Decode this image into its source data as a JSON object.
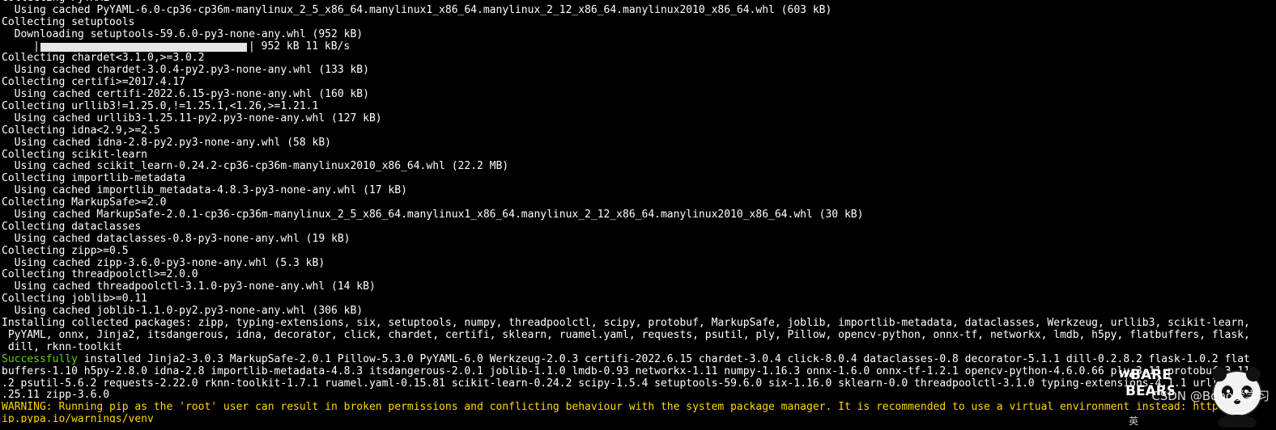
{
  "terminal": {
    "lines": [
      {
        "text": "Collecting PyYAML"
      },
      {
        "text": "  Using cached PyYAML-6.0-cp36-cp36m-manylinux_2_5_x86_64.manylinux1_x86_64.manylinux_2_12_x86_64.manylinux2010_x86_64.whl (603 kB)"
      },
      {
        "text": "Collecting setuptools"
      },
      {
        "text": "  Downloading setuptools-59.6.0-py3-none-any.whl (952 kB)"
      },
      {
        "type": "progress",
        "prefix": "     |",
        "suffix": "| 952 kB 11 kB/s",
        "progress": 1.0
      },
      {
        "text": "Collecting chardet<3.1.0,>=3.0.2"
      },
      {
        "text": "  Using cached chardet-3.0.4-py2.py3-none-any.whl (133 kB)"
      },
      {
        "text": "Collecting certifi>=2017.4.17"
      },
      {
        "text": "  Using cached certifi-2022.6.15-py3-none-any.whl (160 kB)"
      },
      {
        "text": "Collecting urllib3!=1.25.0,!=1.25.1,<1.26,>=1.21.1"
      },
      {
        "text": "  Using cached urllib3-1.25.11-py2.py3-none-any.whl (127 kB)"
      },
      {
        "text": "Collecting idna<2.9,>=2.5"
      },
      {
        "text": "  Using cached idna-2.8-py2.py3-none-any.whl (58 kB)"
      },
      {
        "text": "Collecting scikit-learn"
      },
      {
        "text": "  Using cached scikit_learn-0.24.2-cp36-cp36m-manylinux2010_x86_64.whl (22.2 MB)"
      },
      {
        "text": "Collecting importlib-metadata"
      },
      {
        "text": "  Using cached importlib_metadata-4.8.3-py3-none-any.whl (17 kB)"
      },
      {
        "text": "Collecting MarkupSafe>=2.0"
      },
      {
        "text": "  Using cached MarkupSafe-2.0.1-cp36-cp36m-manylinux_2_5_x86_64.manylinux1_x86_64.manylinux_2_12_x86_64.manylinux2010_x86_64.whl (30 kB)"
      },
      {
        "text": "Collecting dataclasses"
      },
      {
        "text": "  Using cached dataclasses-0.8-py3-none-any.whl (19 kB)"
      },
      {
        "text": "Collecting zipp>=0.5"
      },
      {
        "text": "  Using cached zipp-3.6.0-py3-none-any.whl (5.3 kB)"
      },
      {
        "text": "Collecting threadpoolctl>=2.0.0"
      },
      {
        "text": "  Using cached threadpoolctl-3.1.0-py3-none-any.whl (14 kB)"
      },
      {
        "text": "Collecting joblib>=0.11"
      },
      {
        "text": "  Using cached joblib-1.1.0-py2.py3-none-any.whl (306 kB)"
      },
      {
        "text": "Installing collected packages: zipp, typing-extensions, six, setuptools, numpy, threadpoolctl, scipy, protobuf, MarkupSafe, joblib, importlib-metadata, dataclasses, Werkzeug, urllib3, scikit-learn,"
      },
      {
        "text": " PyYAML, onnx, Jinja2, itsdangerous, idna, decorator, click, chardet, certifi, sklearn, ruamel.yaml, requests, psutil, ply, Pillow, opencv-python, onnx-tf, networkx, lmdb, h5py, flatbuffers, flask,"
      },
      {
        "text": " dill, rknn-toolkit"
      },
      {
        "type": "success",
        "highlight": "Successfully",
        "text": " installed Jinja2-3.0.3 MarkupSafe-2.0.1 Pillow-5.3.0 PyYAML-6.0 Werkzeug-2.0.3 certifi-2022.6.15 chardet-3.0.4 click-8.0.4 dataclasses-0.8 decorator-5.1.1 dill-0.2.8.2 flask-1.0.2 flat"
      },
      {
        "text": "buffers-1.10 h5py-2.8.0 idna-2.8 importlib-metadata-4.8.3 itsdangerous-2.0.1 joblib-1.1.0 lmdb-0.93 networkx-1.11 numpy-1.16.3 onnx-1.6.0 onnx-tf-1.2.1 opencv-python-4.6.0.66 ply-3.11 protobuf-3.11"
      },
      {
        "text": ".2 psutil-5.6.2 requests-2.22.0 rknn-toolkit-1.7.1 ruamel.yaml-0.15.81 scikit-learn-0.24.2 scipy-1.5.4 setuptools-59.6.0 six-1.16.0 sklearn-0.0 threadpoolctl-3.1.0 typing-extensions-4.1.1 urllib3-1"
      },
      {
        "text": ".25.11 zipp-3.6.0"
      },
      {
        "type": "warning",
        "text": "WARNING: Running pip as the 'root' user can result in broken permissions and conflicting behaviour with the system package manager. It is recommended to use a virtual environment instead: https://p"
      },
      {
        "type": "warning",
        "text": "ip.pypa.io/warnings/venv"
      }
    ]
  },
  "watermark": {
    "text": "CSDN @Bobo爱学习",
    "logo_text": "BARE BEARS",
    "small_text": "英"
  },
  "colors": {
    "background": "#000000",
    "foreground": "#ffffff",
    "success": "#5fd700",
    "warning": "#ffd700",
    "progress_bar": "#e6e6e6"
  }
}
